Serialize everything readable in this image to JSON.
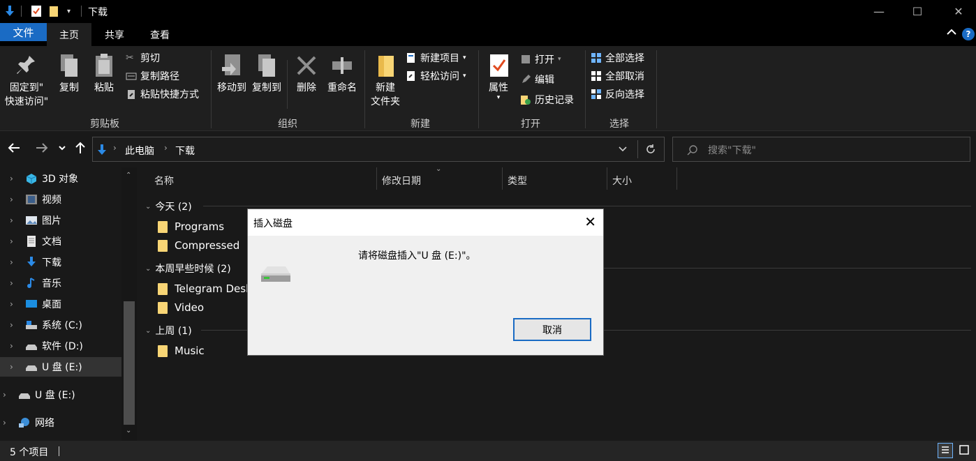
{
  "window": {
    "title": "下载",
    "minimize_glyph": "—",
    "maximize_glyph": "☐",
    "close_glyph": "✕"
  },
  "ribbon_tabs": {
    "file": "文件",
    "home": "主页",
    "share": "共享",
    "view": "查看",
    "help": "?"
  },
  "ribbon": {
    "clipboard": {
      "label": "剪贴板",
      "pin_line1": "固定到\"",
      "pin_line2": "快速访问\"",
      "copy": "复制",
      "paste": "粘贴",
      "cut": "剪切",
      "copy_path": "复制路径",
      "paste_shortcut": "粘贴快捷方式"
    },
    "organize": {
      "label": "组织",
      "move_to": "移动到",
      "copy_to": "复制到",
      "delete": "删除",
      "rename": "重命名"
    },
    "new": {
      "label": "新建",
      "new_folder_line1": "新建",
      "new_folder_line2": "文件夹",
      "new_item": "新建项目",
      "easy_access": "轻松访问"
    },
    "open": {
      "label": "打开",
      "properties": "属性",
      "open": "打开",
      "edit": "编辑",
      "history": "历史记录"
    },
    "select": {
      "label": "选择",
      "select_all": "全部选择",
      "select_none": "全部取消",
      "invert": "反向选择"
    }
  },
  "address": {
    "crumbs": [
      "此电脑",
      "下载"
    ],
    "search_placeholder": "搜索\"下载\""
  },
  "nav_pane": {
    "items": [
      {
        "label": "3D 对象",
        "icon": "3d-objects-icon"
      },
      {
        "label": "视频",
        "icon": "videos-icon"
      },
      {
        "label": "图片",
        "icon": "pictures-icon"
      },
      {
        "label": "文档",
        "icon": "documents-icon"
      },
      {
        "label": "下载",
        "icon": "downloads-icon"
      },
      {
        "label": "音乐",
        "icon": "music-icon"
      },
      {
        "label": "桌面",
        "icon": "desktop-icon"
      },
      {
        "label": "系统 (C:)",
        "icon": "system-drive-icon"
      },
      {
        "label": "软件 (D:)",
        "icon": "drive-icon"
      },
      {
        "label": "U 盘 (E:)",
        "icon": "usb-drive-icon"
      },
      {
        "label": "U 盘 (E:)",
        "icon": "usb-drive-icon"
      },
      {
        "label": "网络",
        "icon": "network-icon"
      }
    ]
  },
  "file_list": {
    "columns": [
      "名称",
      "修改日期",
      "类型",
      "大小"
    ],
    "groups": [
      {
        "label": "今天 (2)",
        "files": [
          "Programs",
          "Compressed"
        ]
      },
      {
        "label": "本周早些时候 (2)",
        "files": [
          "Telegram Desk",
          "Video"
        ]
      },
      {
        "label": "上周 (1)",
        "files": [
          "Music"
        ]
      }
    ]
  },
  "status_bar": {
    "count": "5 个项目"
  },
  "dialog": {
    "title": "插入磁盘",
    "message": "请将磁盘插入\"U 盘 (E:)\"。",
    "cancel": "取消",
    "close_glyph": "✕"
  }
}
